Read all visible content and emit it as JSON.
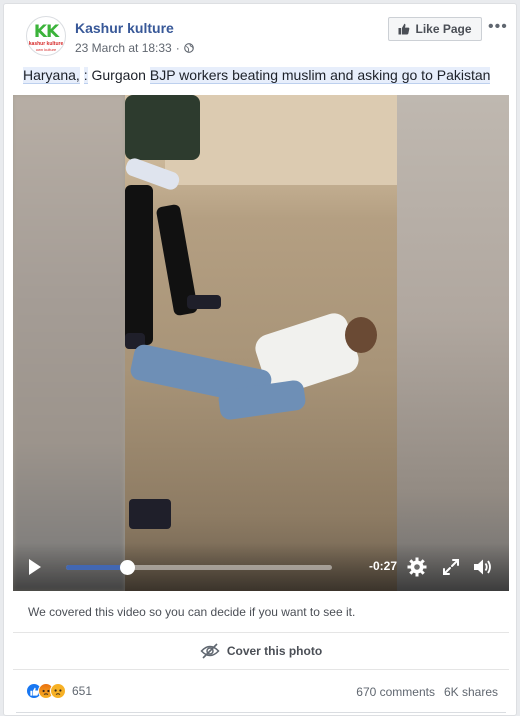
{
  "post": {
    "page_name": "Kashur kulture",
    "avatar": {
      "logo_text": "KK",
      "tagline_1": "kashur kulture",
      "tagline_2": "own kulture"
    },
    "timestamp": "23 March at 18:33",
    "separator": "·",
    "privacy_icon": "globe-icon",
    "caption": {
      "part1": "Haryana,",
      "part2": ":",
      "part3": "Gurgaon",
      "part4": "BJP workers beating muslim and asking go to Pakistan"
    }
  },
  "header": {
    "like_page_label": "Like Page",
    "like_icon": "thumbs-up-icon",
    "more_label": "•••"
  },
  "video": {
    "time_remaining": "-0:27",
    "progress": 0.23,
    "icons": [
      "play-icon",
      "gear-icon",
      "fullscreen-icon",
      "volume-icon"
    ]
  },
  "cover": {
    "note": "We covered this video so you can decide if you want to see it.",
    "button_label": "Cover this photo",
    "button_icon": "eye-slash-icon"
  },
  "footer": {
    "reaction_icons": [
      "like-icon",
      "angry-icon",
      "sad-icon"
    ],
    "reaction_count": "651",
    "comments": "670 comments",
    "shares": "6K shares"
  },
  "colors": {
    "link": "#385898",
    "accent": "#4267b2",
    "like_reaction": "#1877f2",
    "angry_reaction": "#e9710f",
    "sad_reaction": "#f7b125",
    "caption_highlight": "#e7eefb"
  }
}
